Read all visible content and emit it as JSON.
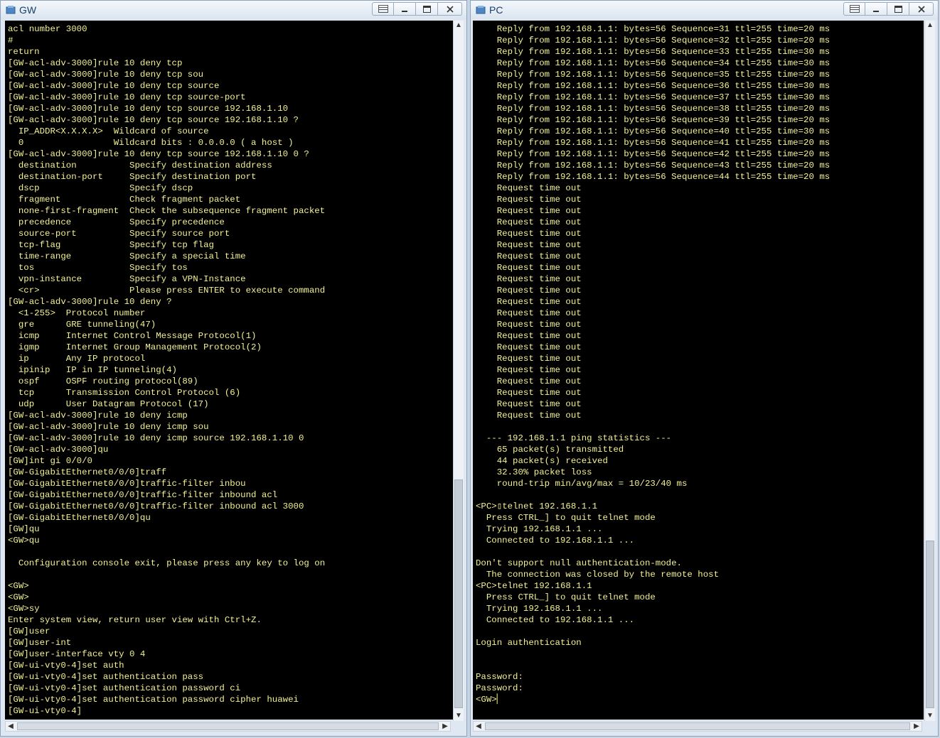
{
  "windows": {
    "gw": {
      "title": "GW",
      "lines": [
        "acl number 3000",
        "#",
        "return",
        "[GW-acl-adv-3000]rule 10 deny tcp",
        "[GW-acl-adv-3000]rule 10 deny tcp sou",
        "[GW-acl-adv-3000]rule 10 deny tcp source",
        "[GW-acl-adv-3000]rule 10 deny tcp source-port",
        "[GW-acl-adv-3000]rule 10 deny tcp source 192.168.1.10",
        "[GW-acl-adv-3000]rule 10 deny tcp source 192.168.1.10 ?",
        "  IP_ADDR<X.X.X.X>  Wildcard of source",
        "  0                 Wildcard bits : 0.0.0.0 ( a host )",
        "[GW-acl-adv-3000]rule 10 deny tcp source 192.168.1.10 0 ?",
        "  destination          Specify destination address",
        "  destination-port     Specify destination port",
        "  dscp                 Specify dscp",
        "  fragment             Check fragment packet",
        "  none-first-fragment  Check the subsequence fragment packet",
        "  precedence           Specify precedence",
        "  source-port          Specify source port",
        "  tcp-flag             Specify tcp flag",
        "  time-range           Specify a special time",
        "  tos                  Specify tos",
        "  vpn-instance         Specify a VPN-Instance",
        "  <cr>                 Please press ENTER to execute command",
        "[GW-acl-adv-3000]rule 10 deny ?",
        "  <1-255>  Protocol number",
        "  gre      GRE tunneling(47)",
        "  icmp     Internet Control Message Protocol(1)",
        "  igmp     Internet Group Management Protocol(2)",
        "  ip       Any IP protocol",
        "  ipinip   IP in IP tunneling(4)",
        "  ospf     OSPF routing protocol(89)",
        "  tcp      Transmission Control Protocol (6)",
        "  udp      User Datagram Protocol (17)",
        "[GW-acl-adv-3000]rule 10 deny icmp",
        "[GW-acl-adv-3000]rule 10 deny icmp sou",
        "[GW-acl-adv-3000]rule 10 deny icmp source 192.168.1.10 0",
        "[GW-acl-adv-3000]qu",
        "[GW]int gi 0/0/0",
        "[GW-GigabitEthernet0/0/0]traff",
        "[GW-GigabitEthernet0/0/0]traffic-filter inbou",
        "[GW-GigabitEthernet0/0/0]traffic-filter inbound acl",
        "[GW-GigabitEthernet0/0/0]traffic-filter inbound acl 3000",
        "[GW-GigabitEthernet0/0/0]qu",
        "[GW]qu",
        "<GW>qu",
        "",
        "  Configuration console exit, please press any key to log on",
        "",
        "<GW>",
        "<GW>",
        "<GW>sy",
        "Enter system view, return user view with Ctrl+Z.",
        "[GW]user",
        "[GW]user-int",
        "[GW]user-interface vty 0 4",
        "[GW-ui-vty0-4]set auth",
        "[GW-ui-vty0-4]set authentication pass",
        "[GW-ui-vty0-4]set authentication password ci",
        "[GW-ui-vty0-4]set authentication password cipher huawei",
        "[GW-ui-vty0-4]"
      ]
    },
    "pc": {
      "title": "PC",
      "lines": [
        "    Reply from 192.168.1.1: bytes=56 Sequence=31 ttl=255 time=20 ms",
        "    Reply from 192.168.1.1: bytes=56 Sequence=32 ttl=255 time=20 ms",
        "    Reply from 192.168.1.1: bytes=56 Sequence=33 ttl=255 time=30 ms",
        "    Reply from 192.168.1.1: bytes=56 Sequence=34 ttl=255 time=30 ms",
        "    Reply from 192.168.1.1: bytes=56 Sequence=35 ttl=255 time=20 ms",
        "    Reply from 192.168.1.1: bytes=56 Sequence=36 ttl=255 time=30 ms",
        "    Reply from 192.168.1.1: bytes=56 Sequence=37 ttl=255 time=30 ms",
        "    Reply from 192.168.1.1: bytes=56 Sequence=38 ttl=255 time=20 ms",
        "    Reply from 192.168.1.1: bytes=56 Sequence=39 ttl=255 time=20 ms",
        "    Reply from 192.168.1.1: bytes=56 Sequence=40 ttl=255 time=30 ms",
        "    Reply from 192.168.1.1: bytes=56 Sequence=41 ttl=255 time=20 ms",
        "    Reply from 192.168.1.1: bytes=56 Sequence=42 ttl=255 time=20 ms",
        "    Reply from 192.168.1.1: bytes=56 Sequence=43 ttl=255 time=20 ms",
        "    Reply from 192.168.1.1: bytes=56 Sequence=44 ttl=255 time=20 ms",
        "    Request time out",
        "    Request time out",
        "    Request time out",
        "    Request time out",
        "    Request time out",
        "    Request time out",
        "    Request time out",
        "    Request time out",
        "    Request time out",
        "    Request time out",
        "    Request time out",
        "    Request time out",
        "    Request time out",
        "    Request time out",
        "    Request time out",
        "    Request time out",
        "    Request time out",
        "    Request time out",
        "    Request time out",
        "    Request time out",
        "    Request time out",
        "",
        "  --- 192.168.1.1 ping statistics ---",
        "    65 packet(s) transmitted",
        "    44 packet(s) received",
        "    32.30% packet loss",
        "    round-trip min/avg/max = 10/23/40 ms",
        "",
        "<PC>▯telnet 192.168.1.1",
        "  Press CTRL_] to quit telnet mode",
        "  Trying 192.168.1.1 ...",
        "  Connected to 192.168.1.1 ...",
        "",
        "Don't support null authentication-mode.",
        "  The connection was closed by the remote host",
        "<PC>telnet 192.168.1.1",
        "  Press CTRL_] to quit telnet mode",
        "  Trying 192.168.1.1 ...",
        "  Connected to 192.168.1.1 ...",
        "",
        "Login authentication",
        "",
        "",
        "Password:",
        "Password:",
        "<GW>▏"
      ]
    }
  }
}
